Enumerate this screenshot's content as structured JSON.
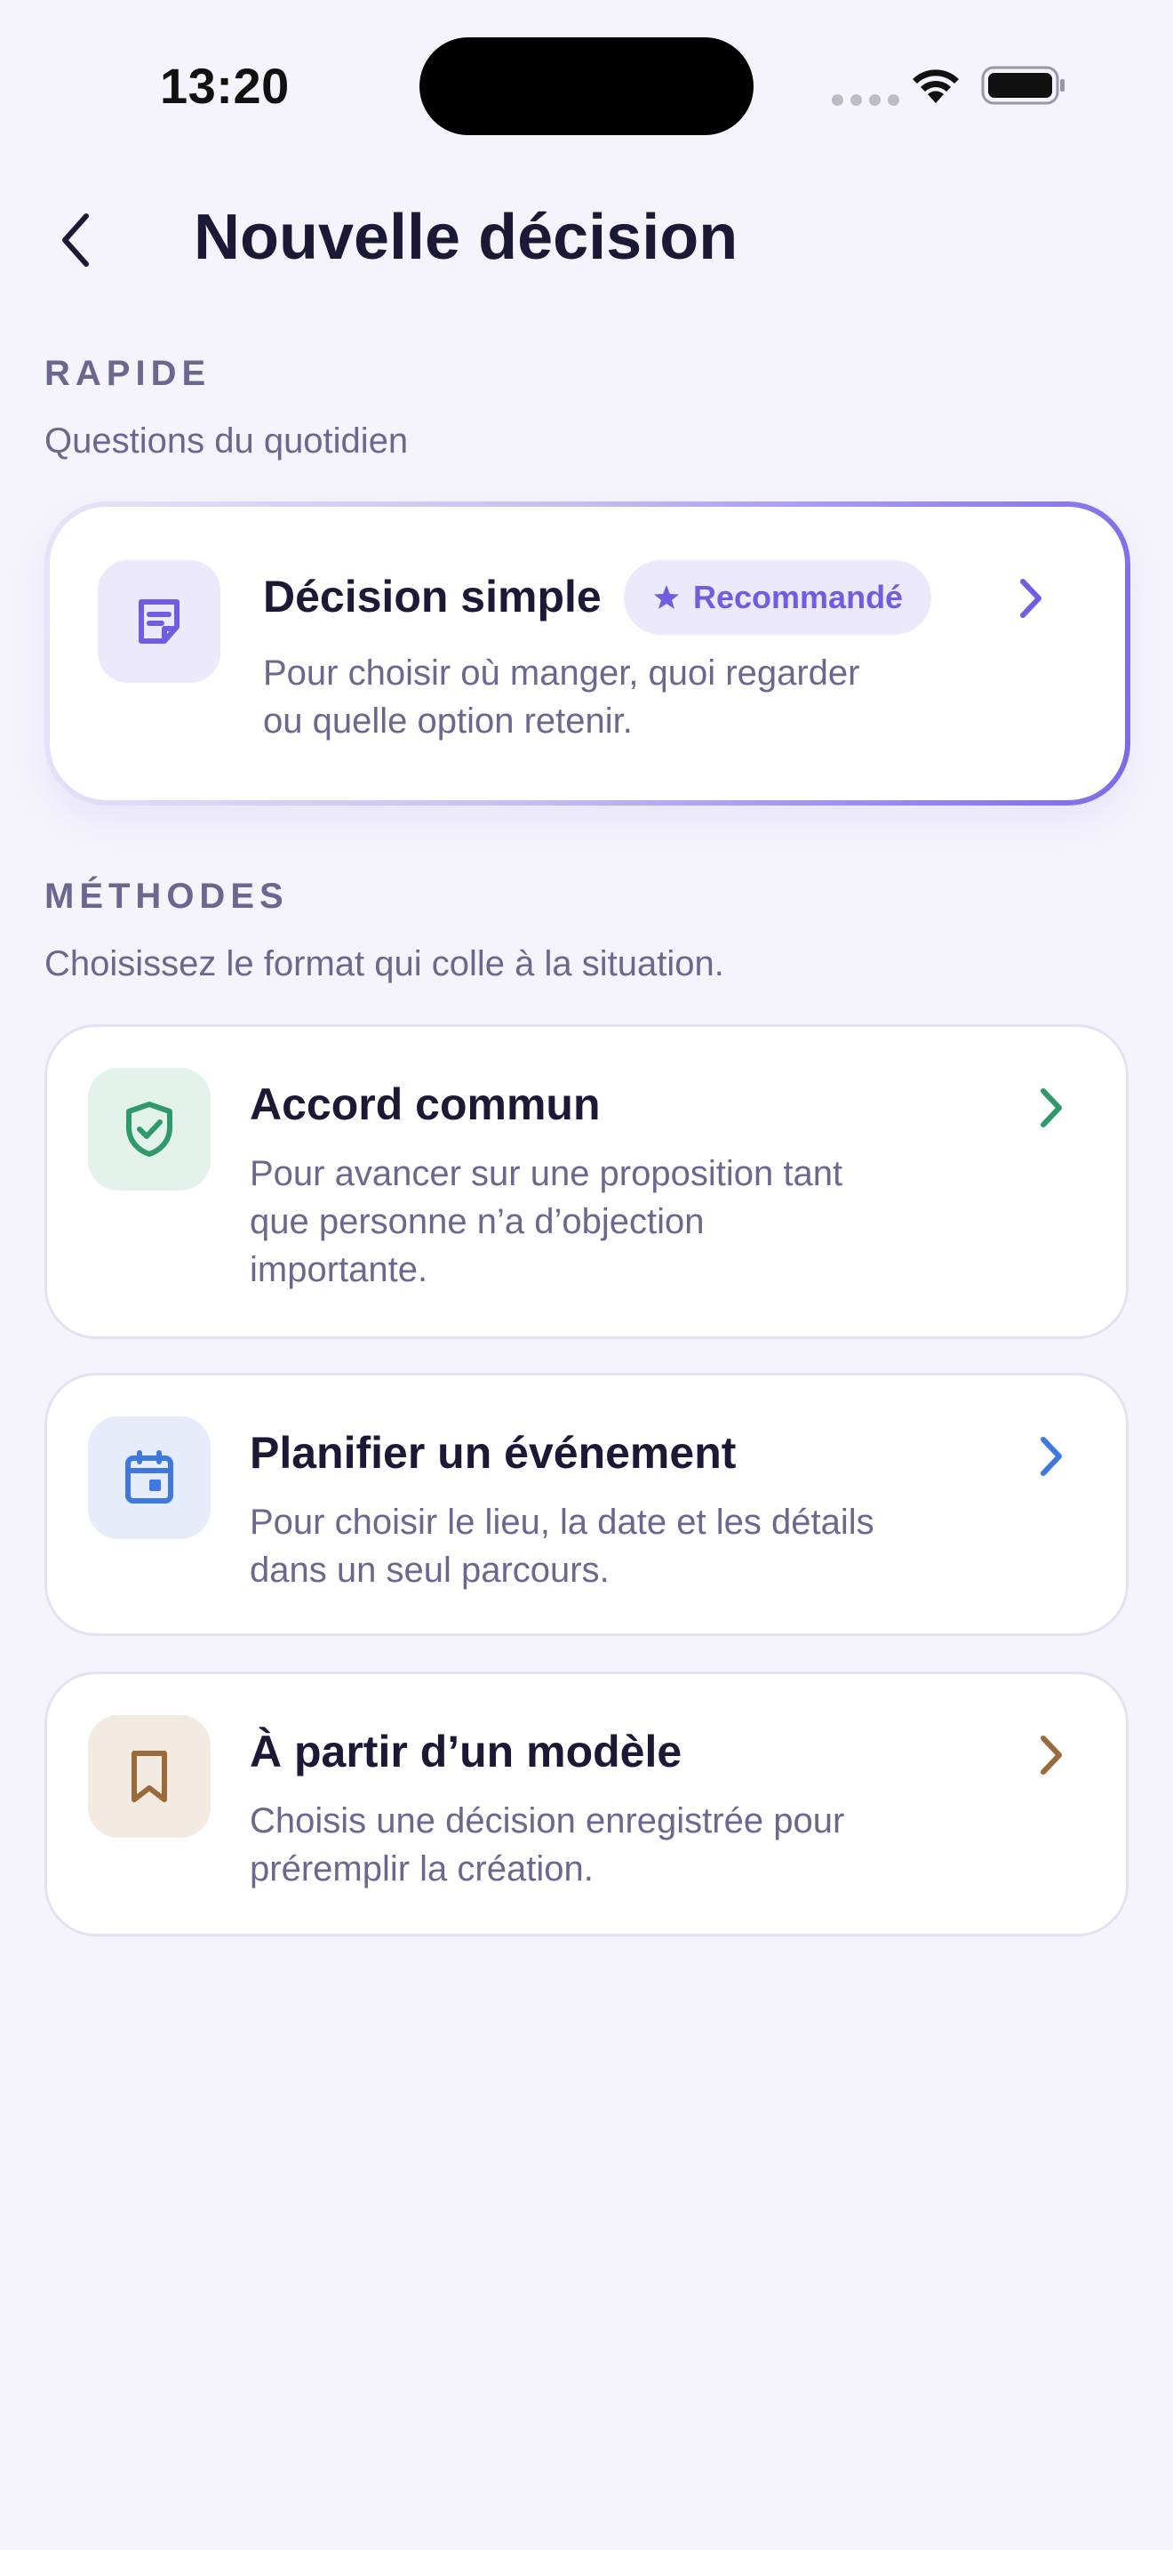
{
  "status_bar": {
    "time": "13:20"
  },
  "header": {
    "title": "Nouvelle décision"
  },
  "quick_section": {
    "label": "RAPIDE",
    "subtitle": "Questions du quotidien",
    "card": {
      "title": "Décision simple",
      "badge": "Recommandé",
      "description_line1": "Pour choisir où manger, quoi regarder",
      "description_line2": "ou quelle option retenir.",
      "icon": "note-icon",
      "accent_color": "#6f5fe0"
    }
  },
  "methods_section": {
    "label": "MÉTHODES",
    "subtitle": "Choisissez le format qui colle à la situation.",
    "cards": [
      {
        "title": "Accord commun",
        "description_line1": "Pour avancer sur une proposition tant",
        "description_line2": "que personne n’a d’objection",
        "description_line3": "importante.",
        "icon": "shield-check-icon",
        "accent_color": "#2e9a6a"
      },
      {
        "title": "Planifier un événement",
        "description_line1": "Pour choisir le lieu, la date et les détails",
        "description_line2": "dans un seul parcours.",
        "icon": "calendar-icon",
        "accent_color": "#3f79e0"
      },
      {
        "title": "À partir d’un modèle",
        "description_line1": "Choisis une décision enregistrée pour",
        "description_line2": "préremplir la création.",
        "icon": "bookmark-icon",
        "accent_color": "#9a6a3a"
      }
    ]
  }
}
